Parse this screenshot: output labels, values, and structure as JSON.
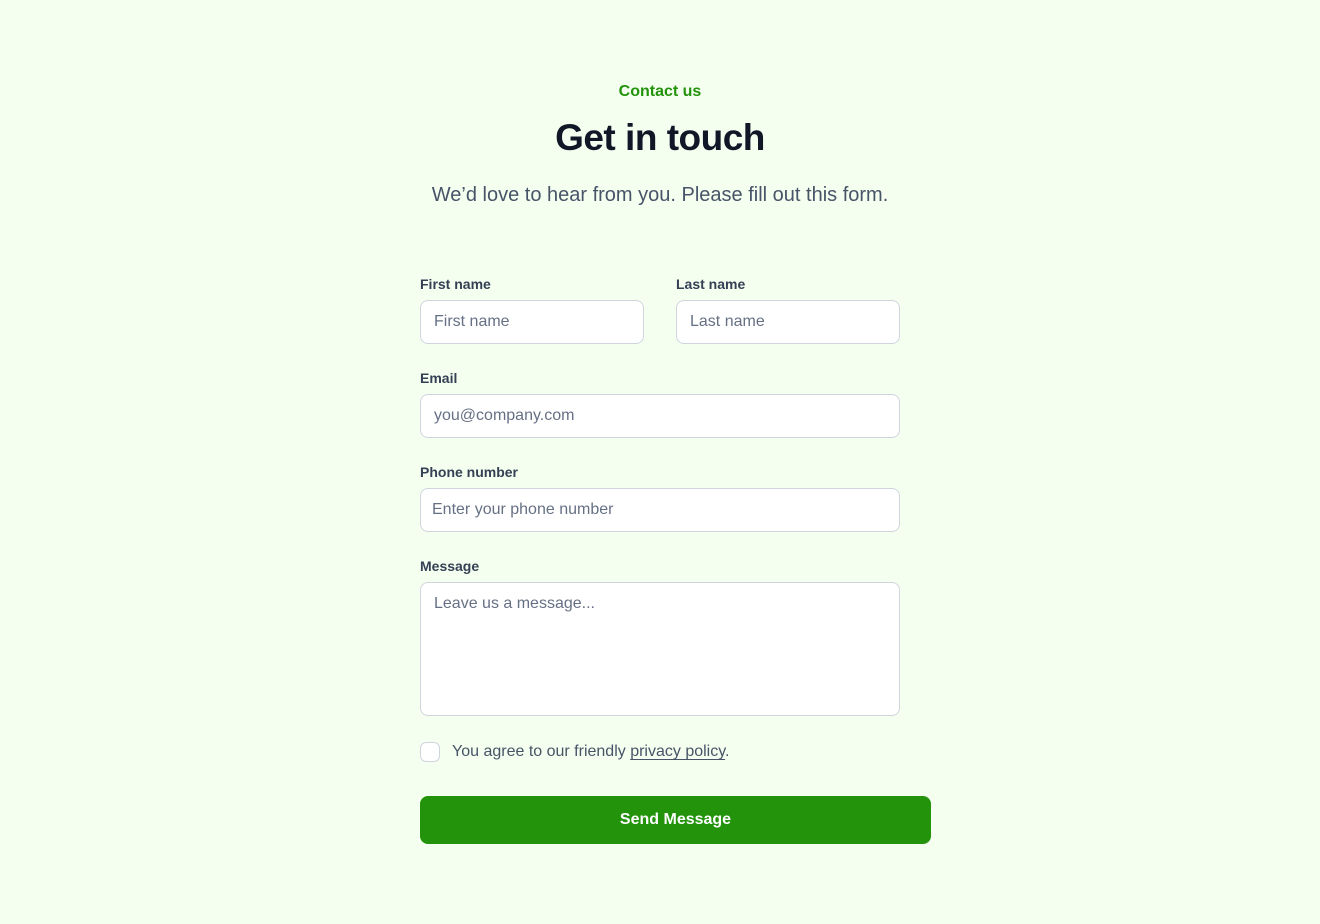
{
  "header": {
    "eyebrow": "Contact us",
    "title": "Get in touch",
    "subtitle": "We’d love to hear from you. Please fill out this form."
  },
  "form": {
    "first_name": {
      "label": "First name",
      "placeholder": "First name",
      "value": ""
    },
    "last_name": {
      "label": "Last name",
      "placeholder": "Last name",
      "value": ""
    },
    "email": {
      "label": "Email",
      "placeholder": "you@company.com",
      "value": ""
    },
    "phone": {
      "label": "Phone number",
      "placeholder": "Enter your phone number",
      "value": ""
    },
    "message": {
      "label": "Message",
      "placeholder": "Leave us a message...",
      "value": ""
    },
    "agree": {
      "checked": false,
      "text_before": "You agree to our friendly ",
      "link_text": "privacy policy",
      "text_after": "."
    },
    "submit_label": "Send Message"
  },
  "colors": {
    "background": "#f5fff0",
    "accent": "#22930b",
    "heading": "#101828",
    "body_text": "#475467",
    "label": "#344054",
    "border": "#d0d5dd"
  }
}
